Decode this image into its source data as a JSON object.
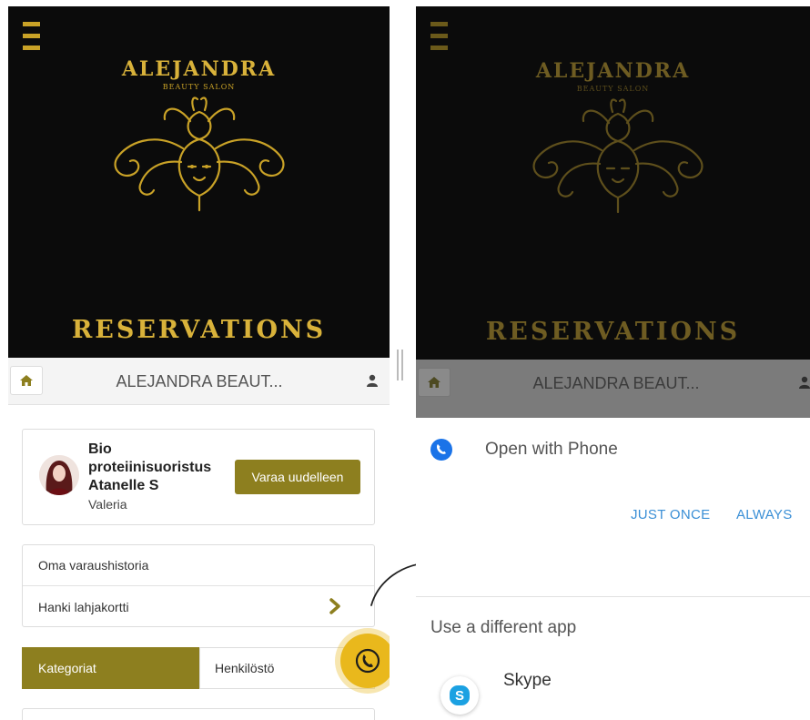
{
  "left": {
    "brand": {
      "name": "ALEJANDRA",
      "subtitle": "BEAUTY SALON",
      "banner": "RESERVATIONS"
    },
    "navbar": {
      "title": "ALEJANDRA BEAUT..."
    },
    "booking_card": {
      "service": "Bio proteiinisuoristus Atanelle S",
      "staff": "Valeria",
      "rebook_label": "Varaa uudelleen"
    },
    "links": [
      {
        "label": "Oma varaushistoria"
      },
      {
        "label": "Hanki lahjakortti"
      }
    ],
    "tabs": [
      {
        "label": "Kategoriat",
        "active": true
      },
      {
        "label": "Henkilöstö",
        "active": false
      }
    ]
  },
  "right": {
    "brand": {
      "name": "ALEJANDRA",
      "subtitle": "BEAUTY SALON",
      "banner": "RESERVATIONS"
    },
    "navbar": {
      "title": "ALEJANDRA BEAUT..."
    },
    "chooser": {
      "open_with": "Open with Phone",
      "just_once": "JUST ONCE",
      "always": "ALWAYS",
      "different_app": "Use a different app",
      "apps": [
        {
          "label": "Skype",
          "icon": "skype-icon"
        }
      ]
    }
  },
  "colors": {
    "gold": "#d9b23a",
    "olive_button": "#8d7f1f",
    "fab_yellow": "#e9b81c",
    "link_blue": "#3a8fd6",
    "phone_blue": "#1a73e8"
  }
}
